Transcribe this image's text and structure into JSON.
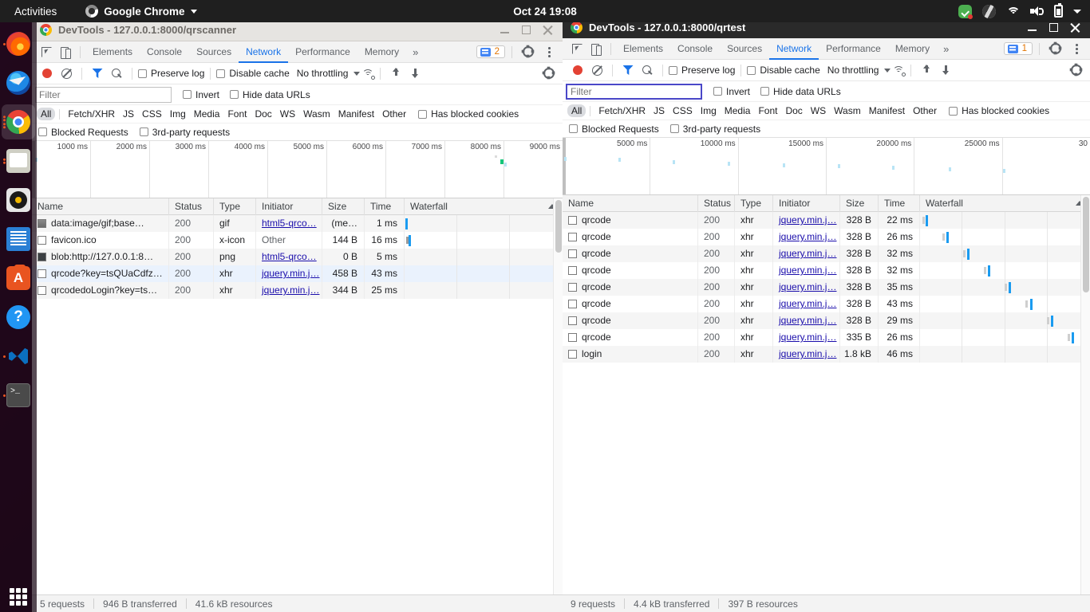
{
  "topbar": {
    "activities": "Activities",
    "app_name": "Google Chrome",
    "clock": "Oct 24  19:08",
    "tray": [
      "todo-icon",
      "accessibility-icon",
      "wifi-icon",
      "volume-icon",
      "battery-icon",
      "system-menu-arrow-icon"
    ]
  },
  "dock": {
    "items": [
      {
        "name": "firefox",
        "label": "Firefox",
        "running": true,
        "active": false
      },
      {
        "name": "thunderbird",
        "label": "Thunderbird Mail",
        "running": false,
        "active": false
      },
      {
        "name": "chrome",
        "label": "Google Chrome",
        "running": true,
        "active": true
      },
      {
        "name": "files",
        "label": "Files",
        "running": true,
        "active": false
      },
      {
        "name": "rhythmbox",
        "label": "Rhythmbox",
        "running": false,
        "active": false
      },
      {
        "name": "writer",
        "label": "LibreOffice Writer",
        "running": false,
        "active": false
      },
      {
        "name": "software",
        "label": "Ubuntu Software",
        "running": false,
        "active": false
      },
      {
        "name": "help",
        "label": "Help",
        "running": false,
        "active": false
      },
      {
        "name": "vscode",
        "label": "Visual Studio Code",
        "running": true,
        "active": false
      },
      {
        "name": "terminal",
        "label": "Terminal",
        "running": true,
        "active": false
      }
    ],
    "show_apps": "Show Applications"
  },
  "windows": [
    {
      "id": "left",
      "title": "DevTools - 127.0.0.1:8000/qrscanner",
      "active": false,
      "tabs": [
        "Elements",
        "Console",
        "Sources",
        "Network",
        "Performance",
        "Memory"
      ],
      "selected_tab": "Network",
      "more_tabs": "»",
      "issues_count": "2",
      "toolbar": {
        "record_label": "Record network log",
        "clear_label": "Clear",
        "filter_label": "Filter",
        "search_label": "Search",
        "preserve_log": "Preserve log",
        "disable_cache": "Disable cache",
        "throttling": "No throttling",
        "import_label": "Import HAR",
        "export_label": "Export HAR"
      },
      "filterbar": {
        "placeholder": "Filter",
        "value": "",
        "focused": false,
        "invert": "Invert",
        "hide_data_urls": "Hide data URLs"
      },
      "types": [
        "All",
        "Fetch/XHR",
        "JS",
        "CSS",
        "Img",
        "Media",
        "Font",
        "Doc",
        "WS",
        "Wasm",
        "Manifest",
        "Other"
      ],
      "selected_type": "All",
      "has_blocked_cookies": "Has blocked cookies",
      "blocked_requests": "Blocked Requests",
      "third_party_requests": "3rd-party requests",
      "overview_labels": [
        "1000 ms",
        "2000 ms",
        "3000 ms",
        "4000 ms",
        "5000 ms",
        "6000 ms",
        "7000 ms",
        "8000 ms",
        "9000 ms"
      ],
      "columns": [
        "Name",
        "Status",
        "Type",
        "Initiator",
        "Size",
        "Time",
        "Waterfall"
      ],
      "rows": [
        {
          "icon": "image-file-icon",
          "name": "data:image/gif;base…",
          "status": "200",
          "type": "gif",
          "initiator": "html5-qrco…",
          "initiator_link": true,
          "size": "(me…",
          "time": "1 ms",
          "wf_start": 0.5,
          "wf_pre": 0,
          "selected": false
        },
        {
          "icon": "generic-file-icon",
          "name": "favicon.ico",
          "status": "200",
          "type": "x-icon",
          "initiator": "Other",
          "initiator_link": false,
          "size": "144 B",
          "time": "16 ms",
          "wf_start": 2.4,
          "wf_pre": 1.2,
          "selected": false
        },
        {
          "icon": "image-file-icon",
          "name": "blob:http://127.0.0.1:8…",
          "status": "200",
          "type": "png",
          "initiator": "html5-qrco…",
          "initiator_link": true,
          "size": "0 B",
          "time": "5 ms",
          "wf_start": 99.0,
          "wf_pre": 0,
          "selected": false
        },
        {
          "icon": "generic-file-icon",
          "name": "qrcode?key=tsQUaCdfz…",
          "status": "200",
          "type": "xhr",
          "initiator": "jquery.min.j…",
          "initiator_link": true,
          "size": "458 B",
          "time": "43 ms",
          "wf_start": 100.5,
          "wf_pre": 0,
          "selected": true
        },
        {
          "icon": "generic-file-icon",
          "name": "qrcodedoLogin?key=ts…",
          "status": "200",
          "type": "xhr",
          "initiator": "jquery.min.j…",
          "initiator_link": true,
          "size": "344 B",
          "time": "25 ms",
          "wf_start": 100.5,
          "wf_pre": 0,
          "selected": false
        }
      ],
      "status": {
        "requests": "5 requests",
        "transferred": "946 B transferred",
        "resources": "41.6 kB resources"
      }
    },
    {
      "id": "right",
      "title": "DevTools - 127.0.0.1:8000/qrtest",
      "active": true,
      "tabs": [
        "Elements",
        "Console",
        "Sources",
        "Network",
        "Performance",
        "Memory"
      ],
      "selected_tab": "Network",
      "more_tabs": "»",
      "issues_count": "1",
      "toolbar": {
        "record_label": "Record network log",
        "clear_label": "Clear",
        "filter_label": "Filter",
        "search_label": "Search",
        "preserve_log": "Preserve log",
        "disable_cache": "Disable cache",
        "throttling": "No throttling",
        "import_label": "Import HAR",
        "export_label": "Export HAR"
      },
      "filterbar": {
        "placeholder": "Filter",
        "value": "",
        "focused": true,
        "invert": "Invert",
        "hide_data_urls": "Hide data URLs"
      },
      "types": [
        "All",
        "Fetch/XHR",
        "JS",
        "CSS",
        "Img",
        "Media",
        "Font",
        "Doc",
        "WS",
        "Wasm",
        "Manifest",
        "Other"
      ],
      "selected_type": "All",
      "has_blocked_cookies": "Has blocked cookies",
      "blocked_requests": "Blocked Requests",
      "third_party_requests": "3rd-party requests",
      "overview_labels": [
        "5000 ms",
        "10000 ms",
        "15000 ms",
        "20000 ms",
        "25000 ms",
        "30"
      ],
      "columns": [
        "Name",
        "Status",
        "Type",
        "Initiator",
        "Size",
        "Time",
        "Waterfall"
      ],
      "rows": [
        {
          "icon": "generic-file-icon",
          "name": "qrcode",
          "status": "200",
          "type": "xhr",
          "initiator": "jquery.min.j…",
          "initiator_link": true,
          "size": "328 B",
          "time": "22 ms",
          "wf_start": 3.5,
          "wf_pre": 1.5,
          "selected": false
        },
        {
          "icon": "generic-file-icon",
          "name": "qrcode",
          "status": "200",
          "type": "xhr",
          "initiator": "jquery.min.j…",
          "initiator_link": true,
          "size": "328 B",
          "time": "26 ms",
          "wf_start": 15.5,
          "wf_pre": 13.3,
          "selected": false
        },
        {
          "icon": "generic-file-icon",
          "name": "qrcode",
          "status": "200",
          "type": "xhr",
          "initiator": "jquery.min.j…",
          "initiator_link": true,
          "size": "328 B",
          "time": "32 ms",
          "wf_start": 27.8,
          "wf_pre": 25.5,
          "selected": false
        },
        {
          "icon": "generic-file-icon",
          "name": "qrcode",
          "status": "200",
          "type": "xhr",
          "initiator": "jquery.min.j…",
          "initiator_link": true,
          "size": "328 B",
          "time": "32 ms",
          "wf_start": 40.0,
          "wf_pre": 37.6,
          "selected": false
        },
        {
          "icon": "generic-file-icon",
          "name": "qrcode",
          "status": "200",
          "type": "xhr",
          "initiator": "jquery.min.j…",
          "initiator_link": true,
          "size": "328 B",
          "time": "35 ms",
          "wf_start": 52.3,
          "wf_pre": 49.8,
          "selected": false
        },
        {
          "icon": "generic-file-icon",
          "name": "qrcode",
          "status": "200",
          "type": "xhr",
          "initiator": "jquery.min.j…",
          "initiator_link": true,
          "size": "328 B",
          "time": "43 ms",
          "wf_start": 64.8,
          "wf_pre": 62.0,
          "selected": false
        },
        {
          "icon": "generic-file-icon",
          "name": "qrcode",
          "status": "200",
          "type": "xhr",
          "initiator": "jquery.min.j…",
          "initiator_link": true,
          "size": "328 B",
          "time": "29 ms",
          "wf_start": 77.0,
          "wf_pre": 74.5,
          "selected": false
        },
        {
          "icon": "generic-file-icon",
          "name": "qrcode",
          "status": "200",
          "type": "xhr",
          "initiator": "jquery.min.j…",
          "initiator_link": true,
          "size": "335 B",
          "time": "26 ms",
          "wf_start": 89.0,
          "wf_pre": 86.7,
          "selected": false
        },
        {
          "icon": "generic-file-icon",
          "name": "login",
          "status": "200",
          "type": "xhr",
          "initiator": "jquery.min.j…",
          "initiator_link": true,
          "size": "1.8 kB",
          "time": "46 ms",
          "wf_start": 99.4,
          "wf_pre": 0,
          "selected": false
        }
      ],
      "status": {
        "requests": "9 requests",
        "transferred": "4.4 kB transferred",
        "resources": "397 B resources"
      }
    }
  ],
  "colors": {
    "accent": "#1a73e8",
    "waterfall_bar": "#1a9bf0",
    "record": "#e34234",
    "selected_row": "#eaf2fd",
    "link": "#1a0dab"
  }
}
